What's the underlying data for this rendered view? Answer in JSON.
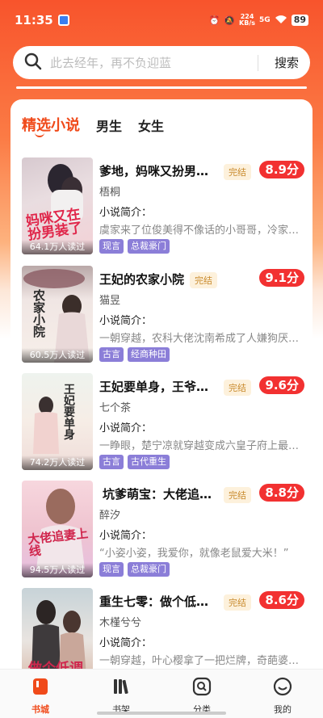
{
  "status_bar": {
    "time": "11:35",
    "net_speed_value": "224",
    "net_speed_unit": "KB/s",
    "signal": "5G",
    "battery": "89"
  },
  "search": {
    "placeholder": "此去经年，再不负迎蓝",
    "button_label": "搜索"
  },
  "tabs": [
    "精选小说",
    "男生",
    "女生"
  ],
  "books": [
    {
      "title": "爹地，妈咪又扮男…",
      "status": "完结",
      "score": "8.9分",
      "author": "梧桐",
      "intro_label": "小说简介：",
      "intro": "虞家来了位俊美得不像话的小哥哥，冷家…",
      "genres": [
        "现言",
        "总裁豪门"
      ],
      "reads": "64.1万人读过",
      "cover_text": "妈咪又在扮男装了"
    },
    {
      "title": "王妃的农家小院",
      "status": "完结",
      "score": "9.1分",
      "author": "猫昱",
      "intro_label": "小说简介：",
      "intro": "一朝穿越，农科大佬沈南希成了人嫌狗厌…",
      "genres": [
        "古言",
        "经商种田"
      ],
      "reads": "60.5万人读过",
      "cover_text": "农家小院"
    },
    {
      "title": "王妃要单身，王爷…",
      "status": "完结",
      "score": "9.6分",
      "author": "七个茶",
      "intro_label": "小说简介：",
      "intro": "一睁眼，楚宁凉就穿越变成六皇子府上最…",
      "genres": [
        "古言",
        "古代重生"
      ],
      "reads": "74.2万人读过",
      "cover_text": "王妃要单身"
    },
    {
      "title": "坑爹萌宝：大佬追…",
      "status": "完结",
      "score": "8.8分",
      "author": "醉汐",
      "intro_label": "小说简介：",
      "intro": "“小姿小姿，我爱你，就像老鼠爱大米！”",
      "genres": [
        "现言",
        "总裁豪门"
      ],
      "reads": "94.5万人读过",
      "cover_text": "大佬追妻上线"
    },
    {
      "title": "重生七零：做个低…",
      "status": "完结",
      "score": "8.6分",
      "author": "木槿兮兮",
      "intro_label": "小说简介：",
      "intro": "一朝穿越，叶心樱拿了一把烂牌，奇葩婆…",
      "genres": [],
      "reads": "",
      "cover_text": "做个低调"
    }
  ],
  "bottom_nav": [
    {
      "label": "书城",
      "icon": "book-city-icon"
    },
    {
      "label": "书架",
      "icon": "bookshelf-icon"
    },
    {
      "label": "分类",
      "icon": "category-icon"
    },
    {
      "label": "我的",
      "icon": "profile-icon"
    }
  ],
  "colors": {
    "accent": "#f04a1a",
    "score_bg": "#f23131",
    "genre_bg": "#8b7ed8",
    "status_tag_bg": "#fdf1dc"
  }
}
